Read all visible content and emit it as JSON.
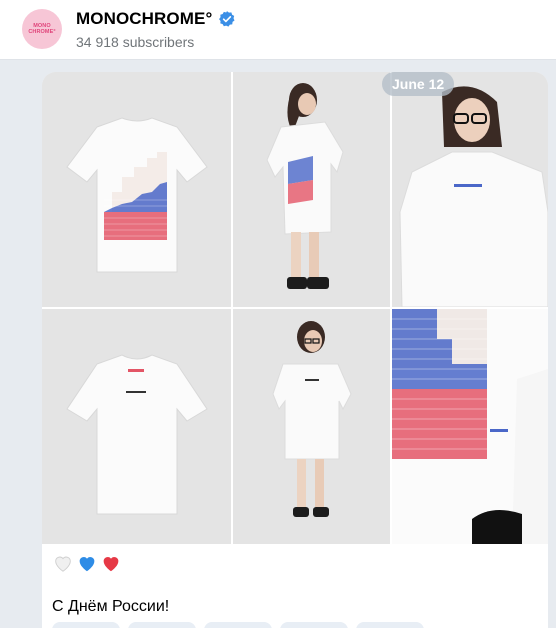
{
  "channel": {
    "name": "MONOCHROME°",
    "subscribers": "34 918 subscribers",
    "avatar_text_line1": "MONO",
    "avatar_text_line2": "CHROME°",
    "avatar_color": "#f7c6d6",
    "verified_color": "#3b8fe6",
    "verified_icon": "verified-badge-icon"
  },
  "post": {
    "date": "June 12",
    "hearts": [
      "white-heart-icon",
      "blue-heart-icon",
      "red-heart-icon"
    ],
    "heart_colors": [
      "#f0f0f0",
      "#2e8ce6",
      "#e63946"
    ],
    "text": "С Днём России!",
    "photos": [
      "tshirt-flag-back-photo",
      "model-side-flag-photo",
      "model-front-closeup-photo",
      "tshirt-front-photo",
      "model-full-front-photo",
      "flag-print-closeup-photo"
    ],
    "print_colors": {
      "white": "#efe6e2",
      "blue": "#3a5bbf",
      "red": "#e04a5a"
    }
  }
}
